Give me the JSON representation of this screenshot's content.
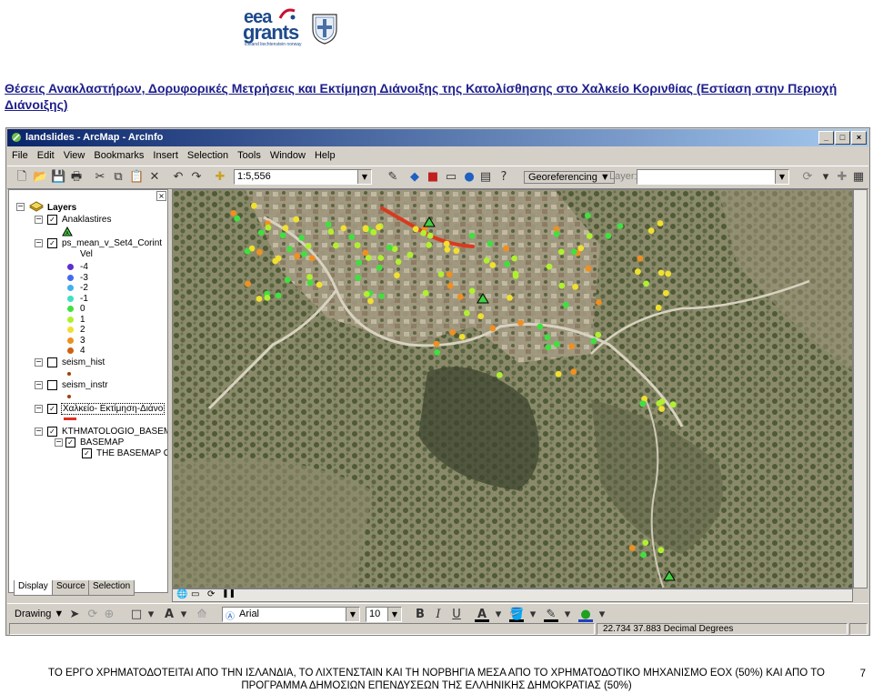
{
  "logos": {
    "eea_line1": "eea",
    "eea_line2": "grants",
    "eea_line3": "iceland liechtenstein norway"
  },
  "doc_title": "Θέσεις Ανακλαστήρων, Δορυφορικές Μετρήσεις και Εκτίμηση Διάνοιξης της Κατολίσθησης στο Χαλκείο Κορινθίας (Εστίαση στην Περιοχή Διάνοιξης)",
  "window": {
    "title": "landslides - ArcMap - ArcInfo",
    "buttons": [
      "_",
      "□",
      "×"
    ]
  },
  "menu": [
    "File",
    "Edit",
    "View",
    "Bookmarks",
    "Insert",
    "Selection",
    "Tools",
    "Window",
    "Help"
  ],
  "toolbar": {
    "scale": "1:5,556",
    "georeferencing": "Georeferencing",
    "layer_label": "Layer:",
    "layer_value": ""
  },
  "toc": {
    "root": "Layers",
    "layers": [
      {
        "name": "Anaklastires",
        "checked": true
      },
      {
        "name": "ps_mean_v_Set4_Corint",
        "checked": true,
        "field": "Vel"
      },
      {
        "name": "seism_hist",
        "checked": false
      },
      {
        "name": "seism_instr",
        "checked": false
      },
      {
        "name": "Χαλκείο- Εκτίμηση-Διάνο",
        "checked": true
      },
      {
        "name": "KTHMATOLOGIO_BASEM",
        "checked": true
      },
      {
        "name": "BASEMAP",
        "checked": true
      },
      {
        "name": "THE BASEMAP OI",
        "checked": true
      }
    ],
    "legend": [
      {
        "label": "-4",
        "color": "#5b2fd0"
      },
      {
        "label": "-3",
        "color": "#3f6bf0"
      },
      {
        "label": "-2",
        "color": "#3fb0f0"
      },
      {
        "label": "-1",
        "color": "#40e0c0"
      },
      {
        "label": "0",
        "color": "#40e040"
      },
      {
        "label": "1",
        "color": "#b0f030"
      },
      {
        "label": "2",
        "color": "#f0e030"
      },
      {
        "label": "3",
        "color": "#f09020"
      },
      {
        "label": "4",
        "color": "#d06010"
      }
    ],
    "tabs": [
      "Display",
      "Source",
      "Selection"
    ]
  },
  "drawing": {
    "label": "Drawing",
    "font": "Arial",
    "size": "10"
  },
  "status": {
    "coords": "22.734  37.883 Decimal Degrees"
  },
  "footer": {
    "line1": "ΤΟ ΕΡΓΟ ΧΡΗΜΑΤΟΔΟΤΕΙΤΑΙ ΑΠΟ ΤΗΝ ΙΣΛΑΝΔΙΑ, ΤΟ ΛΙΧΤΕΝΣΤΑΙΝ ΚΑΙ ΤΗ ΝΟΡΒΗΓΙΑ ΜΕΣΑ ΑΠΟ ΤΟ ΧΡΗΜΑΤΟΔΟΤΙΚΟ ΜΗΧΑΝΙΣΜΟ ΕΟΧ (50%) ΚΑΙ ΑΠΟ ΤΟ",
    "line2": "ΠΡΟΓΡΑΜΜΑ ΔΗΜΟΣΙΩΝ ΕΠΕΝΔΥΣΕΩΝ ΤΗΣ ΕΛΛΗΝΙΚΗΣ ΔΗΜΟΚΡΑΤΙΑΣ (50%)",
    "page": "7"
  }
}
